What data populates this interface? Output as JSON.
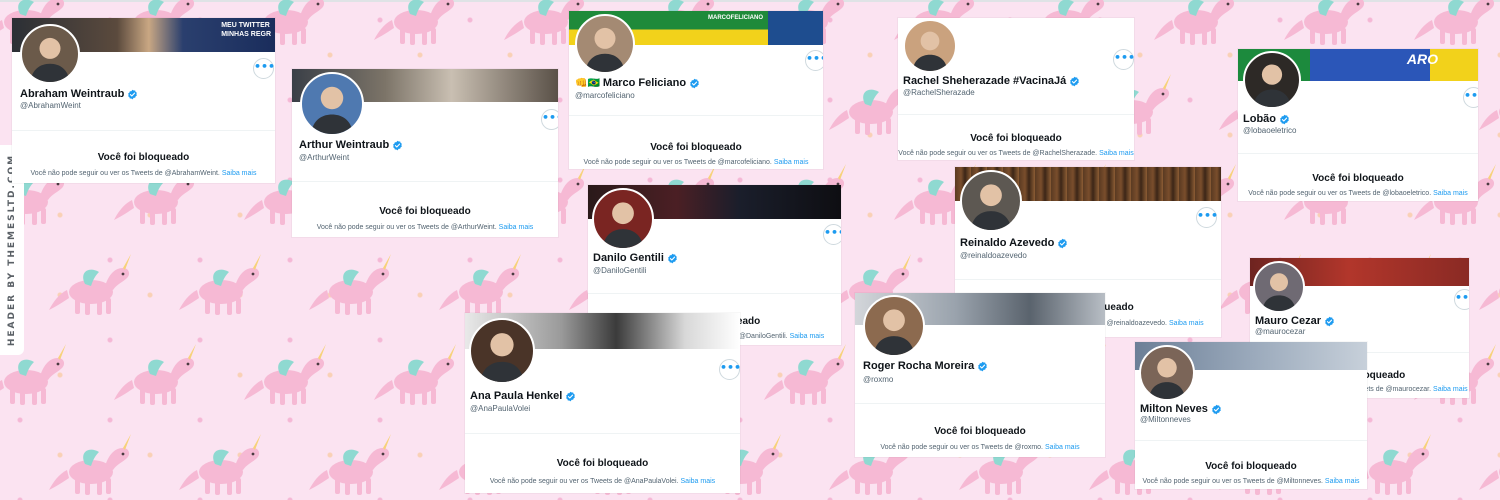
{
  "side_credit": "HEADER BY THEMESLTD.COM",
  "banner_texts": {
    "abraham": "MEU TWITTER\nMINHAS REGR",
    "marco": "MARCOFELICIANO",
    "lobao": "ARO"
  },
  "common": {
    "blocked_title": "Você foi bloqueado",
    "blocked_prefix": "Você não pode seguir ou ver os Tweets de ",
    "learn_more": "Saiba mais",
    "more_icon": "•••"
  },
  "marco_emoji": "👊🇧🇷",
  "profiles": {
    "abraham": {
      "name": "Abraham Weintraub",
      "handle": "@AbrahamWeint",
      "msg": "Você não pode seguir ou ver os Tweets de @AbrahamWeint."
    },
    "arthur": {
      "name": "Arthur Weintraub",
      "handle": "@ArthurWeint",
      "msg": "Você não pode seguir ou ver os Tweets de @ArthurWeint."
    },
    "marco": {
      "name": "Marco Feliciano",
      "handle": "@marcofeliciano",
      "msg": "Você não pode seguir ou ver os Tweets de @marcofeliciano."
    },
    "rachel": {
      "name": "Rachel Sheherazade #VacinaJá",
      "handle": "@RachelSherazade",
      "msg": "Você não pode seguir ou ver os Tweets de @RachelSherazade."
    },
    "lobao": {
      "name": "Lobão",
      "handle": "@lobaoeletrico",
      "msg": "Você não pode seguir ou ver os Tweets de @lobaoeletrico."
    },
    "danilo": {
      "name": "Danilo Gentili",
      "handle": "@DaniloGentili",
      "msg": "Você não pode seguir ou ver os Tweets de @DaniloGentili."
    },
    "reinaldo": {
      "name": "Reinaldo Azevedo",
      "handle": "@reinaldoazevedo",
      "msg": "Você não pode seguir ou ver os Tweets de @reinaldoazevedo."
    },
    "mauro": {
      "name": "Mauro Cezar",
      "handle": "@maurocezar",
      "msg": "Você não pode seguir ou ver os Tweets de @maurocezar."
    },
    "ana": {
      "name": "Ana Paula Henkel",
      "handle": "@AnaPaulaVolei",
      "msg": "Você não pode seguir ou ver os Tweets de @AnaPaulaVolei."
    },
    "roger": {
      "name": "Roger Rocha Moreira",
      "handle": "@roxmo",
      "msg": "Você não pode seguir ou ver os Tweets de @roxmo."
    },
    "milton": {
      "name": "Milton Neves",
      "handle": "@Miltonneves",
      "msg": "Você não pode seguir ou ver os Tweets de @Miltonneves."
    }
  },
  "icons": {
    "verified": "verified-badge-icon",
    "more": "more-options-icon",
    "unicorn": "unicorn-icon"
  },
  "colors": {
    "verified_blue": "#1d9bf0",
    "link_blue": "#1d9bf0",
    "background_pink": "#fbe3f1",
    "unicorn_pink": "#f6b9d4",
    "wing_teal": "#8fd9d1"
  }
}
